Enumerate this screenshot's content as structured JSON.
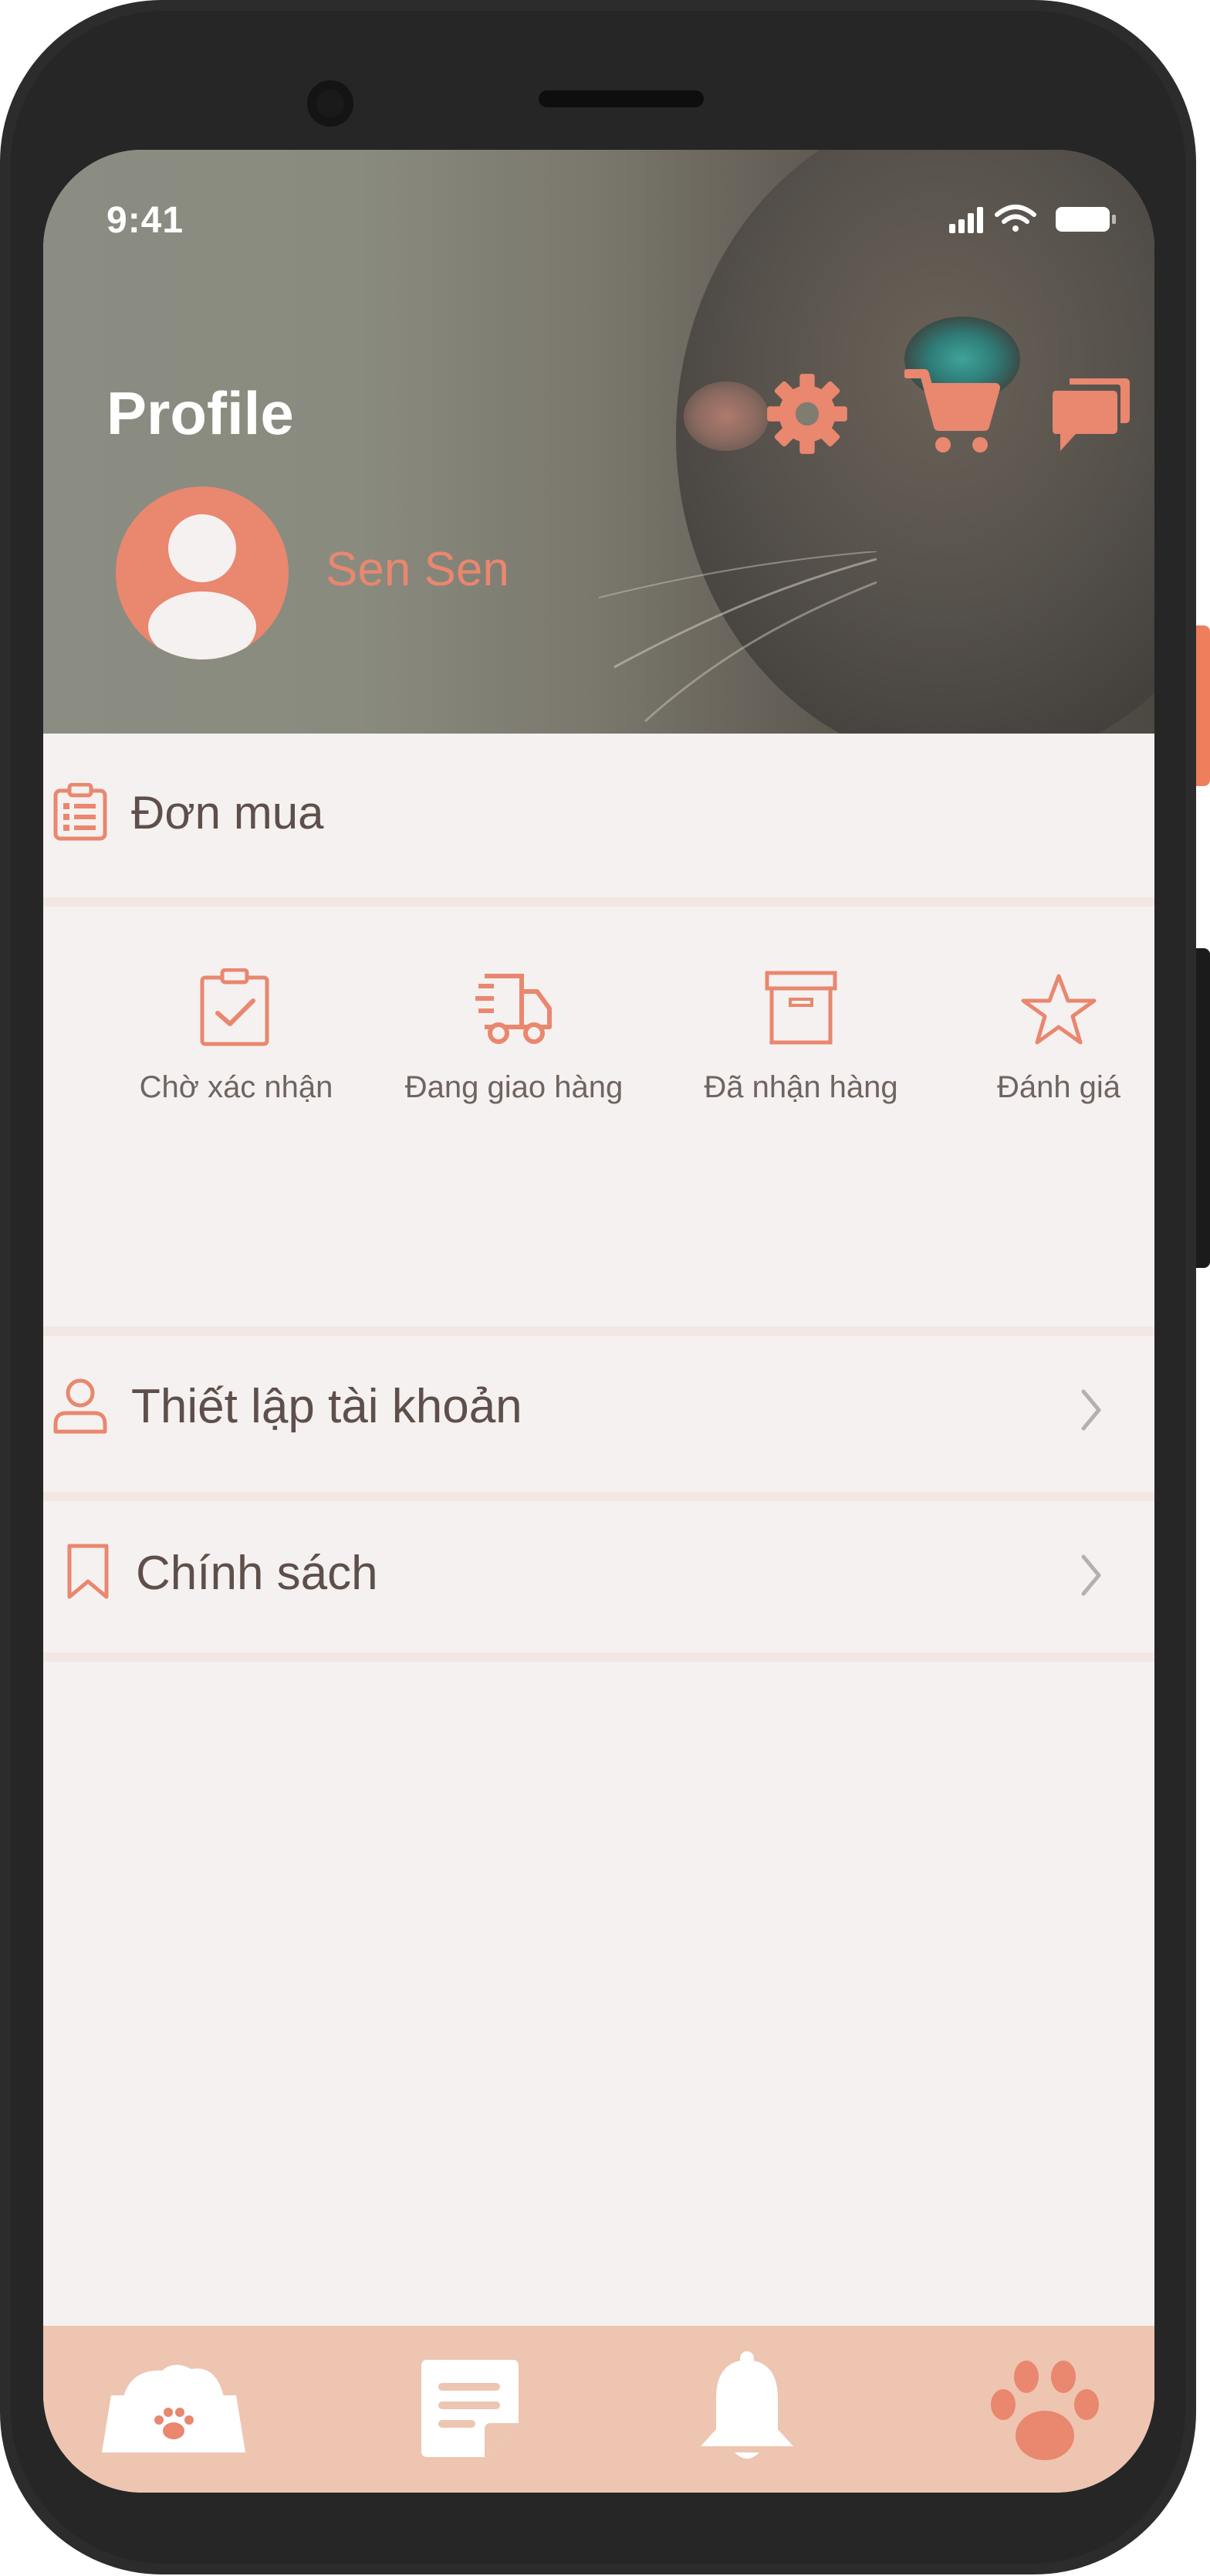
{
  "status_bar": {
    "time": "9:41"
  },
  "header": {
    "title": "Profile",
    "username": "Sen Sen",
    "actions": [
      {
        "icon": "gear-icon"
      },
      {
        "icon": "cart-icon"
      },
      {
        "icon": "chat-icon"
      }
    ]
  },
  "orders": {
    "label": "Đơn mua",
    "icon": "clipboard-list-icon",
    "statuses": [
      {
        "label": "Chờ xác nhận",
        "icon": "clipboard-check-icon"
      },
      {
        "label": "Đang giao hàng",
        "icon": "delivery-truck-icon"
      },
      {
        "label": "Đã nhận hàng",
        "icon": "archive-box-icon"
      },
      {
        "label": "Đánh giá",
        "icon": "star-icon"
      }
    ]
  },
  "menu": [
    {
      "label": "Thiết lập tài khoản",
      "icon": "user-icon"
    },
    {
      "label": "Chính sách",
      "icon": "bookmark-icon"
    }
  ],
  "bottom_nav": [
    {
      "icon": "pet-bowl-icon"
    },
    {
      "icon": "notes-icon"
    },
    {
      "icon": "bell-icon"
    },
    {
      "icon": "paw-icon",
      "active": true
    }
  ],
  "colors": {
    "accent": "#e9876f",
    "background": "#f5f1f0",
    "nav_background": "#edc5b1",
    "text": "#5e4f4a"
  }
}
